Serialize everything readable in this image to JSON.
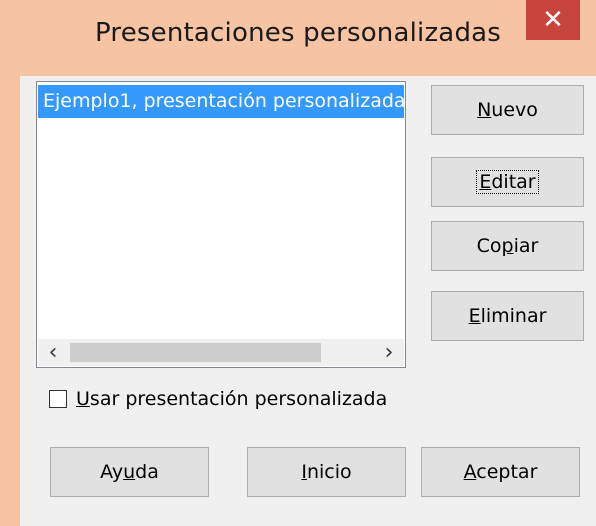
{
  "window": {
    "title": "Presentaciones personalizadas",
    "close_glyph": "✕"
  },
  "list": {
    "items": [
      "Ejemplo1, presentación personalizada"
    ],
    "selected_index": 0
  },
  "side_buttons": {
    "nuevo": {
      "prefix": "",
      "mnemonic": "N",
      "suffix": "uevo"
    },
    "editar": {
      "prefix": "",
      "mnemonic": "E",
      "suffix": "ditar"
    },
    "copiar": {
      "prefix": "Co",
      "mnemonic": "p",
      "suffix": "iar"
    },
    "eliminar": {
      "prefix": "",
      "mnemonic": "E",
      "suffix": "liminar"
    }
  },
  "checkbox": {
    "checked": false,
    "mnemonic": "U",
    "suffix": "sar presentación personalizada"
  },
  "bottom_buttons": {
    "ayuda": {
      "prefix": "Ay",
      "mnemonic": "u",
      "suffix": "da"
    },
    "inicio": {
      "prefix": "",
      "mnemonic": "I",
      "suffix": "nicio"
    },
    "aceptar": {
      "prefix": "",
      "mnemonic": "A",
      "suffix": "ceptar"
    }
  },
  "icons": {
    "scroll_left": "‹",
    "scroll_right": "›"
  }
}
